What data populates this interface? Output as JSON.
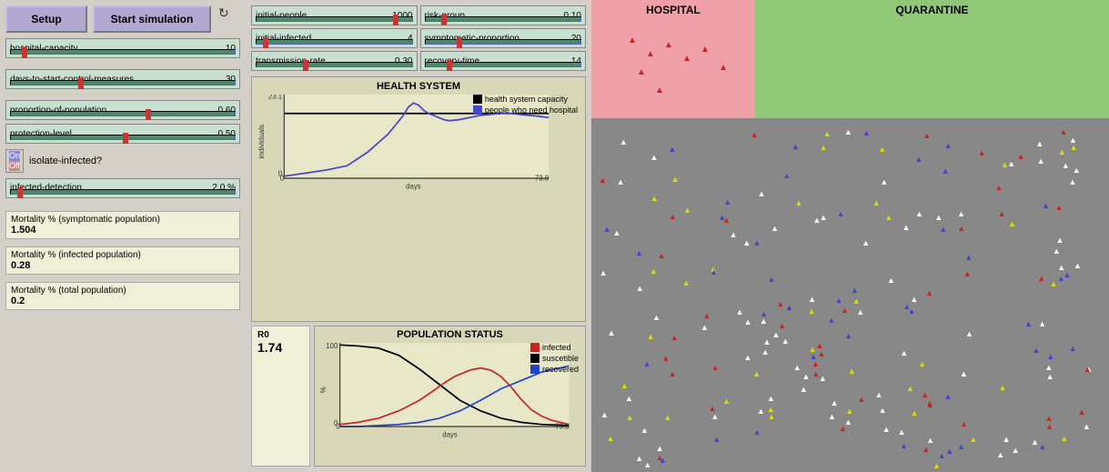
{
  "buttons": {
    "setup_label": "Setup",
    "start_label": "Start simulation"
  },
  "left_sliders": [
    {
      "name": "hospital-capacity",
      "value": "10",
      "handle_pct": 5
    },
    {
      "name": "days-to-start-control-measures",
      "value": "30",
      "handle_pct": 30
    },
    {
      "name": "proportion-of-population",
      "value": "0.60",
      "handle_pct": 60
    },
    {
      "name": "protection-level",
      "value": "0.50",
      "handle_pct": 50
    },
    {
      "name": "infected-detection",
      "value": "2.0 %",
      "handle_pct": 3
    }
  ],
  "toggle": {
    "on_label": "On",
    "off_label": "Off",
    "question": "isolate-infected?"
  },
  "stats": [
    {
      "label": "Mortality % (symptomatic population)",
      "value": "1.504"
    },
    {
      "label": "Mortality % (infected population)",
      "value": "0.28"
    },
    {
      "label": "Mortality % (total population)",
      "value": "0.2"
    }
  ],
  "middle_sliders": [
    {
      "name": "initial-people",
      "value": "1000",
      "handle_pct": 90
    },
    {
      "name": "risk-group",
      "value": "0.10",
      "handle_pct": 10
    },
    {
      "name": "initial-infected",
      "value": "4",
      "handle_pct": 5
    },
    {
      "name": "symptomatic-proportion",
      "value": "20",
      "handle_pct": 20
    },
    {
      "name": "transmission-rate",
      "value": "0.30",
      "handle_pct": 30
    },
    {
      "name": "recovery-time",
      "value": "14",
      "handle_pct": 14
    }
  ],
  "health_chart": {
    "title": "HEALTH SYSTEM",
    "y_max": "23.1",
    "y_min": "0",
    "x_max": "73.8",
    "x_min": "0",
    "x_label": "days",
    "y_label": "individuals",
    "legend": [
      {
        "label": "health system capacity",
        "color": "#000000"
      },
      {
        "label": "people who need hospital",
        "color": "#4444cc"
      }
    ]
  },
  "population_chart": {
    "title": "POPULATION STATUS",
    "y_max": "100",
    "y_min": "0",
    "x_max": "73.8",
    "x_min": "0",
    "x_label": "days",
    "y_label": "%",
    "legend": [
      {
        "label": "infected",
        "color": "#cc2222"
      },
      {
        "label": "suscetible",
        "color": "#000000"
      },
      {
        "label": "recovered",
        "color": "#2244cc"
      }
    ]
  },
  "r0": {
    "label": "R0",
    "value": "1.74"
  },
  "simulation": {
    "hospital_label": "HOSPITAL",
    "quarantine_label": "QUARANTINE"
  }
}
